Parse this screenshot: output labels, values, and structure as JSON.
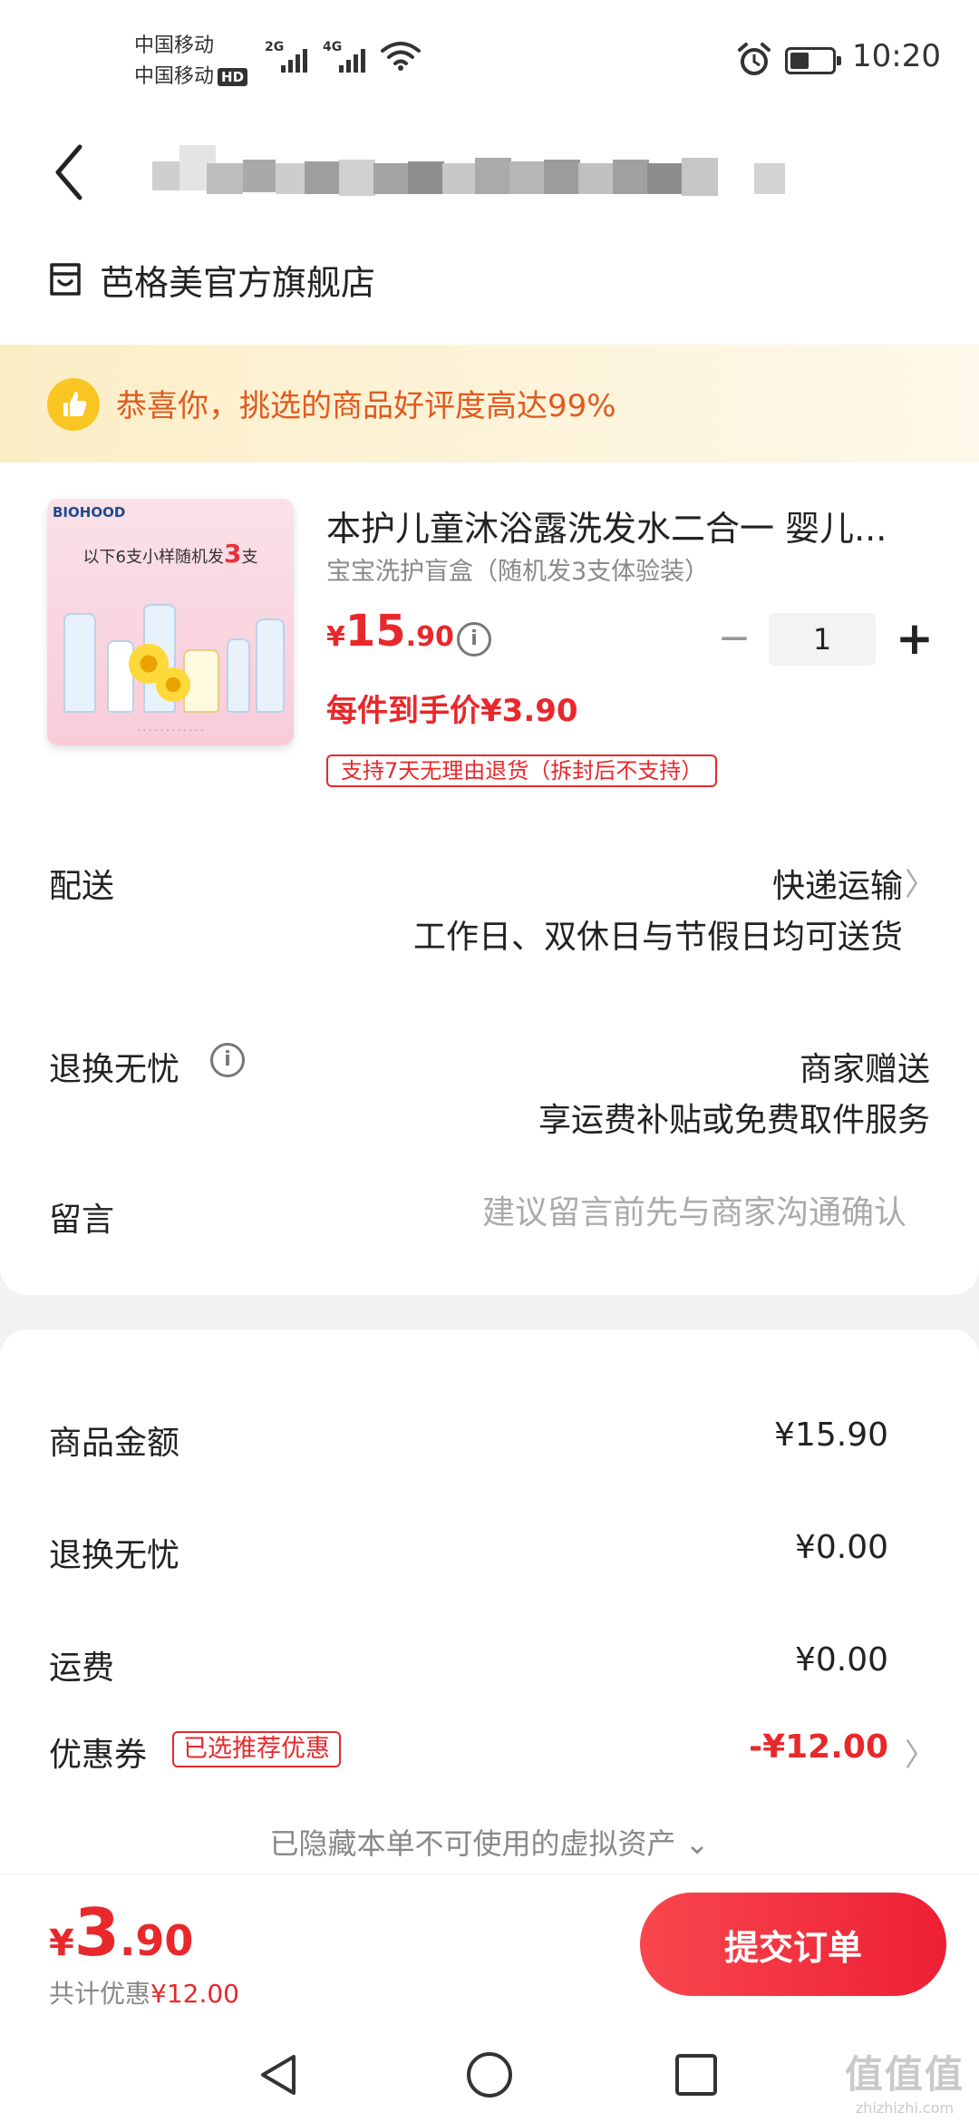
{
  "status_bar": {
    "carrier1": "中国移动",
    "carrier2": "中国移动",
    "hd_badge": "HD",
    "net1": "2G",
    "net2": "4G",
    "time": "10:20",
    "battery_level": 0.45
  },
  "header": {
    "back_icon": "chevron-left-icon",
    "store_name": "芭格美官方旗舰店"
  },
  "banner": {
    "icon": "thumbs-up-icon",
    "text": "恭喜你，挑选的商品好评度高达99%"
  },
  "product": {
    "image_logo": "BIOHOOD",
    "image_text_prefix": "以下6支小样随机发",
    "image_text_highlight": "3",
    "image_text_suffix": "支",
    "title": "本护儿童沐浴露洗发水二合一 婴儿...",
    "subtitle": "宝宝洗护盲盒（随机发3支体验装）",
    "price_symbol": "¥",
    "price_int": "15",
    "price_dec": ".90",
    "quantity": "1",
    "minus": "−",
    "plus": "+",
    "unit_price": "每件到手价¥3.90",
    "return_tag": "支持7天无理由退货（拆封后不支持）"
  },
  "rows": {
    "delivery_label": "配送",
    "delivery_value": "快递运输",
    "delivery_note": "工作日、双休日与节假日均可送货",
    "exchange_label": "退换无忧",
    "exchange_value": "商家赠送",
    "exchange_note": "享运费补贴或免费取件服务",
    "remark_label": "留言",
    "remark_placeholder": "建议留言前先与商家沟通确认"
  },
  "summary": {
    "goods_label": "商品金额",
    "goods_value": "¥15.90",
    "exchange_label": "退换无忧",
    "exchange_value": "¥0.00",
    "shipping_label": "运费",
    "shipping_value": "¥0.00",
    "coupon_label": "优惠券",
    "coupon_tag": "已选推荐优惠",
    "coupon_value": "-¥12.00",
    "hidden_assets": "已隐藏本单不可使用的虚拟资产 ⌄"
  },
  "bottom": {
    "total_symbol": "¥",
    "total_int": "3",
    "total_dec": ".90",
    "saved_prefix": "共计优惠",
    "saved_value": "¥12.00",
    "submit_label": "提交订单"
  },
  "watermark": {
    "big": "值值值",
    "small": "zhizhizhi.com"
  },
  "colors": {
    "accent_red": "#e8282b",
    "banner_orange": "#e05a20"
  }
}
